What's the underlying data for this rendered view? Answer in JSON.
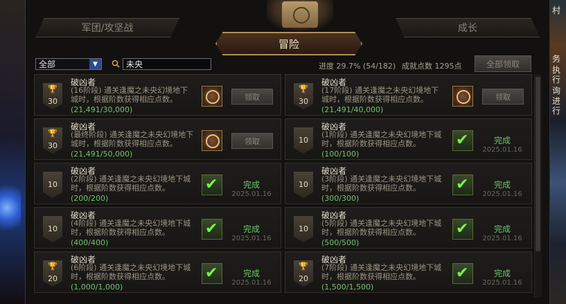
{
  "window": {
    "tabs": {
      "left": "军团/攻坚战",
      "active": "冒险",
      "right": "成长"
    }
  },
  "toolbar": {
    "filter_value": "全部",
    "search_value": "未央",
    "progress_text": "进度 29.7% (54/182)",
    "points_text": "成就点数 1295点",
    "claim_all_label": "全部领取"
  },
  "side_text": [
    "村",
    "务",
    "执行",
    "询",
    "进行"
  ],
  "cards": [
    {
      "title": "破凶者",
      "desc": "(16阶段) 通关逢魔之未央幻境地下城时，根据阶数获得相应点数。",
      "progress": "(21,491/30,000)",
      "badge": "30",
      "badge_trophy": true,
      "status": "claim",
      "claim_label": "领取"
    },
    {
      "title": "破凶者",
      "desc": "(17阶段) 通关逢魔之未央幻境地下城时，根据阶数获得相应点数。",
      "progress": "(21,491/40,000)",
      "badge": "30",
      "badge_trophy": true,
      "status": "claim",
      "claim_label": "领取"
    },
    {
      "title": "破凶者",
      "desc": "(最终阶段) 通关逢魔之未央幻境地下城时，根据阶数获得相应点数。",
      "progress": "(21,491/50,000)",
      "badge": "30",
      "badge_trophy": true,
      "status": "claim",
      "claim_label": "领取"
    },
    {
      "title": "破凶者",
      "desc": "(1阶段) 通关逢魔之未央幻境地下城时，根据阶数获得相应点数。",
      "progress": "(100/100)",
      "badge": "10",
      "badge_trophy": false,
      "status": "done",
      "done_label": "完成",
      "date": "2025.01.16"
    },
    {
      "title": "破凶者",
      "desc": "(2阶段) 通关逢魔之未央幻境地下城时，根据阶数获得相应点数。",
      "progress": "(200/200)",
      "badge": "10",
      "badge_trophy": false,
      "status": "done",
      "done_label": "完成",
      "date": "2025.01.16"
    },
    {
      "title": "破凶者",
      "desc": "(3阶段) 通关逢魔之未央幻境地下城时，根据阶数获得相应点数。",
      "progress": "(300/300)",
      "badge": "10",
      "badge_trophy": false,
      "status": "done",
      "done_label": "完成",
      "date": "2025.01.16"
    },
    {
      "title": "破凶者",
      "desc": "(4阶段) 通关逢魔之未央幻境地下城时，根据阶数获得相应点数。",
      "progress": "(400/400)",
      "badge": "10",
      "badge_trophy": false,
      "status": "done",
      "done_label": "完成",
      "date": "2025.01.16"
    },
    {
      "title": "破凶者",
      "desc": "(5阶段) 通关逢魔之未央幻境地下城时，根据阶数获得相应点数。",
      "progress": "(500/500)",
      "badge": "10",
      "badge_trophy": false,
      "status": "done",
      "done_label": "完成",
      "date": "2025.01.16"
    },
    {
      "title": "破凶者",
      "desc": "(6阶段) 通关逢魔之未央幻境地下城时，根据阶数获得相应点数。",
      "progress": "(1,000/1,000)",
      "badge": "20",
      "badge_trophy": true,
      "status": "done",
      "done_label": "完成",
      "date": "2025.01.16"
    },
    {
      "title": "破凶者",
      "desc": "(7阶段) 通关逢魔之未央幻境地下城时，根据阶数获得相应点数。",
      "progress": "(1,500/1,500)",
      "badge": "20",
      "badge_trophy": true,
      "status": "done",
      "done_label": "完成",
      "date": "2025.01.16"
    }
  ]
}
